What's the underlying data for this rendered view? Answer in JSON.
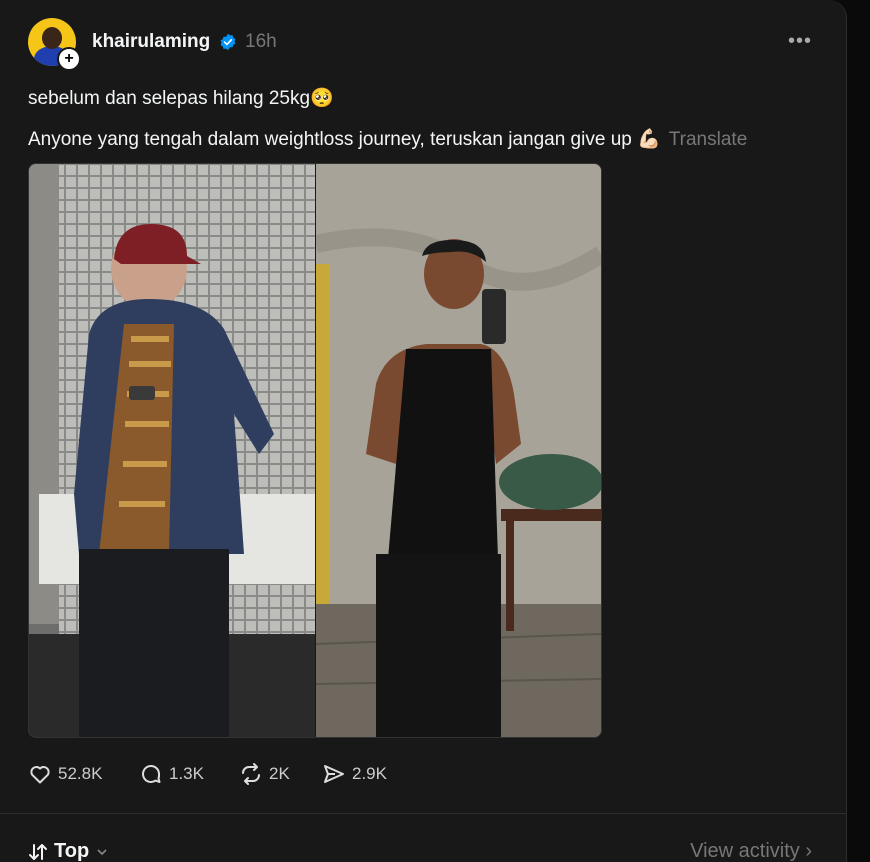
{
  "post": {
    "username": "khairulaming",
    "time": "16h",
    "more_label": "•••",
    "line1": "sebelum dan selepas hilang 25kg🥺",
    "line2": "Anyone yang tengah dalam weightloss journey, teruskan jangan give up 💪🏻",
    "translate": "Translate"
  },
  "actions": {
    "likes": "52.8K",
    "comments": "1.3K",
    "reposts": "2K",
    "shares": "2.9K"
  },
  "footer": {
    "sort_label": "Top",
    "view_activity": "View activity ›"
  },
  "colors": {
    "background": "#181818",
    "verified": "#0095f6",
    "muted": "#777777"
  }
}
